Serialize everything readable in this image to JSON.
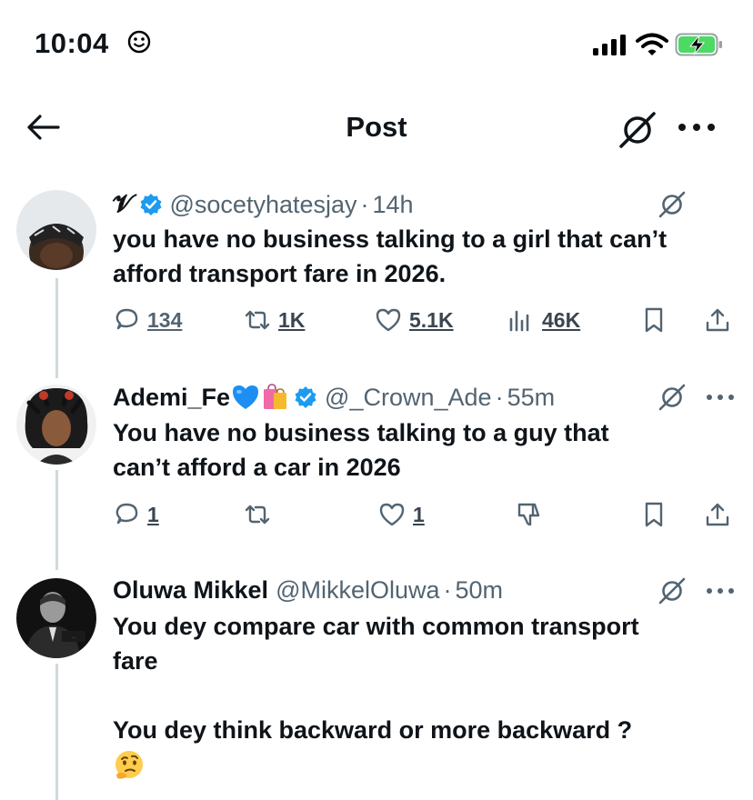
{
  "status_bar": {
    "time": "10:04"
  },
  "header": {
    "title": "Post"
  },
  "posts": [
    {
      "name": "𝓥",
      "handle": "@socetyhatesjay",
      "separator": "·",
      "time": "14h",
      "text": [
        "you have no business talking to a girl that can’t",
        "afford transport fare in 2026."
      ],
      "replies": "134",
      "reposts": "1K",
      "likes": "5.1K",
      "views": "46K"
    },
    {
      "name": "Ademi_Fe",
      "handle": "@_Crown_Ade",
      "separator": "·",
      "time": "55m",
      "text": [
        "You have no business talking to a guy that",
        "can’t afford a car in 2026"
      ],
      "replies": "1",
      "likes": "1"
    },
    {
      "name": "Oluwa Mikkel",
      "handle": "@MikkelOluwa",
      "separator": "·",
      "time": "50m",
      "text": [
        "You dey compare car with common transport",
        "fare",
        "",
        "You dey think backward or more backward ?"
      ]
    }
  ],
  "colors": {
    "text": "#0f1419",
    "secondary": "#536471",
    "verified": "#1d9bf0",
    "thread_line": "#cfd9de",
    "battery_green": "#4cd964"
  },
  "icons": [
    "smiley-icon",
    "signal-icon",
    "wifi-icon",
    "battery-charging-icon",
    "back-arrow-icon",
    "grok-icon",
    "more-icon",
    "verified-badge-icon",
    "reply-icon",
    "repost-icon",
    "like-icon",
    "views-icon",
    "bookmark-icon",
    "share-icon",
    "downvote-icon",
    "blue-heart-icon",
    "shopping-bags-icon",
    "thinking-face-icon"
  ]
}
